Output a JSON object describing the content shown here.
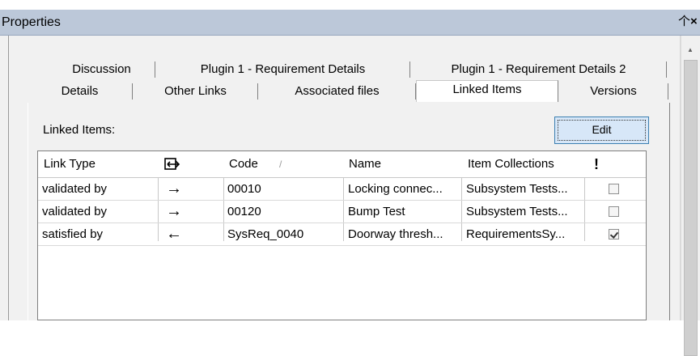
{
  "window": {
    "title": "Properties"
  },
  "tabs_row1": [
    "Discussion",
    "Plugin 1 - Requirement Details",
    "Plugin 1 - Requirement Details 2"
  ],
  "tabs_row2": [
    "Details",
    "Other Links",
    "Associated files",
    "Linked Items",
    "Versions"
  ],
  "active_tab": "Linked Items",
  "linked_items": {
    "label": "Linked Items:",
    "edit_label": "Edit",
    "columns": {
      "link_type": "Link Type",
      "code": "Code",
      "code_sort": "/",
      "name": "Name",
      "collections": "Item Collections",
      "flag": "!"
    },
    "rows": [
      {
        "link_type": "validated by",
        "direction": "→",
        "code": "00010",
        "name": "Locking connec...",
        "collections": "Subsystem Tests...",
        "checked": false
      },
      {
        "link_type": "validated by",
        "direction": "→",
        "code": "00120",
        "name": "Bump Test",
        "collections": "Subsystem Tests...",
        "checked": false
      },
      {
        "link_type": "satisfied by",
        "direction": "←",
        "code": "SysReq_0040",
        "name": "Doorway thresh...",
        "collections": "RequirementsSy...",
        "checked": true
      }
    ]
  }
}
